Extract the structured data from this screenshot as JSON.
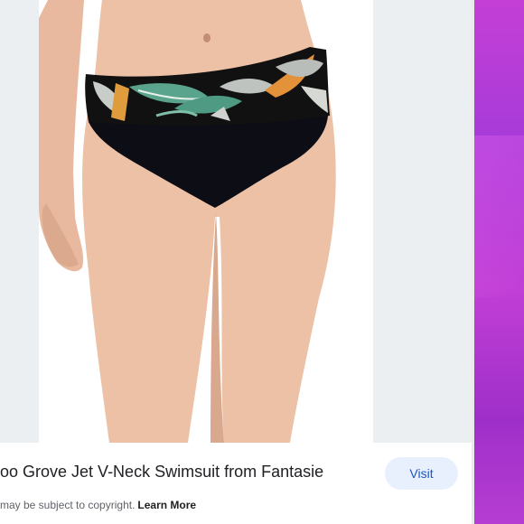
{
  "result": {
    "title": "oo Grove Jet V-Neck Swimsuit from Fantasie",
    "copyright_text": "may be subject to copyright.",
    "learn_more": "Learn More",
    "visit_label": "Visit"
  },
  "colors": {
    "visit_bg": "#e8f0fe",
    "visit_text": "#1a56c5",
    "wallpaper": "#b63dd3",
    "preview_bg": "#eceff1"
  }
}
